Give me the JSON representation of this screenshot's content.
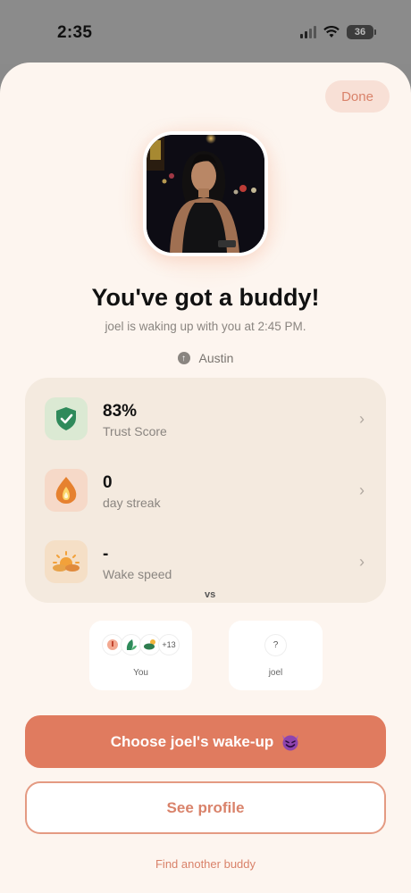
{
  "status_bar": {
    "time": "2:35",
    "battery": "36"
  },
  "header": {
    "done_label": "Done"
  },
  "hero": {
    "title": "You've got a buddy!",
    "subtitle": "joel is waking up with you at 2:45 PM.",
    "location": "Austin"
  },
  "stats": [
    {
      "value": "83%",
      "label": "Trust Score",
      "icon": "shield-check-icon",
      "color": "#dbe9d3"
    },
    {
      "value": "0",
      "label": "day streak",
      "icon": "flame-icon",
      "color": "#f6d9c8"
    },
    {
      "value": "-",
      "label": "Wake speed",
      "icon": "sunrise-icon",
      "color": "#f5dfc6"
    }
  ],
  "compare": {
    "you_label": "You",
    "you_more": "+13",
    "vs": "vs",
    "joel_label": "joel",
    "joel_badge": "?"
  },
  "actions": {
    "primary": "Choose joel's wake-up",
    "secondary": "See profile",
    "link": "Find another buddy"
  },
  "colors": {
    "accent": "#e07b5f",
    "background": "#fdf5ef"
  }
}
